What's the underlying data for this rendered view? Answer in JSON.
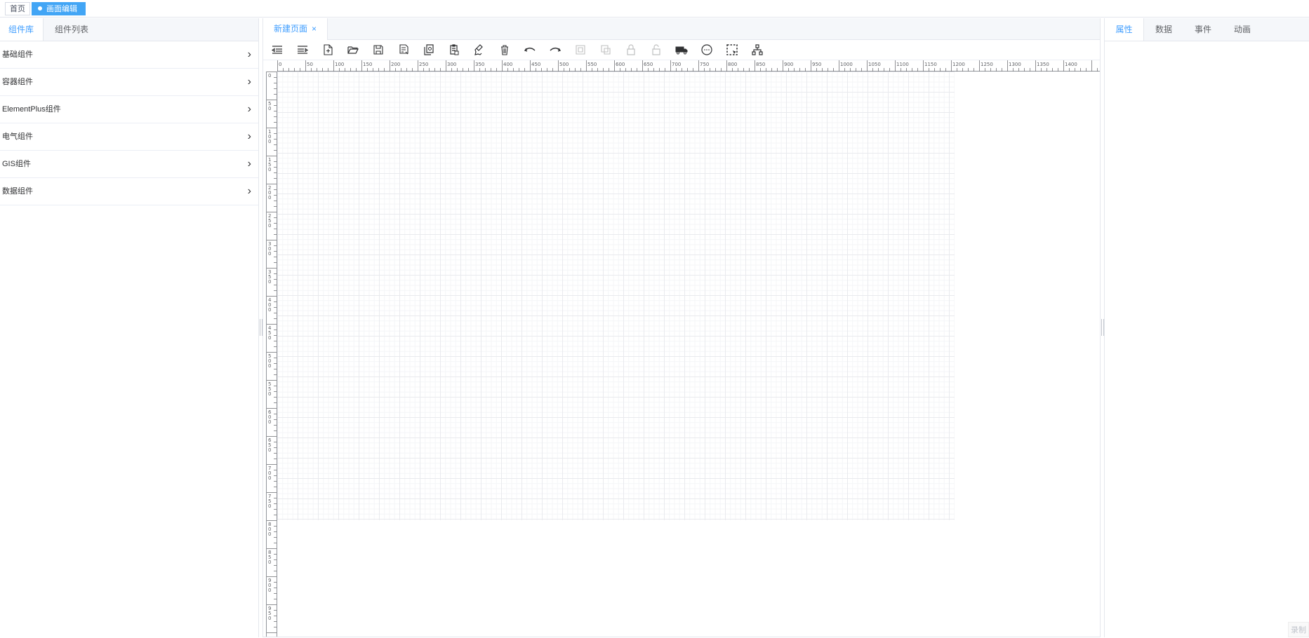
{
  "top_tabs": {
    "home": "首页",
    "active": "画面编辑",
    "close": "×"
  },
  "left_panel": {
    "tabs": [
      "组件库",
      "组件列表"
    ],
    "groups": [
      "基础组件",
      "容器组件",
      "ElementPlus组件",
      "电气组件",
      "GIS组件",
      "数据组件"
    ],
    "chevron": "›"
  },
  "center": {
    "page_tab": "新建页面",
    "close": "×",
    "ruler_top_labels": [
      "0",
      "50",
      "100",
      "150",
      "200",
      "250",
      "300",
      "350",
      "400",
      "450",
      "500",
      "550",
      "600",
      "650",
      "700",
      "750",
      "800",
      "850",
      "900",
      "950",
      "1000",
      "1050",
      "1100",
      "1150",
      "1200",
      "1250",
      "1300",
      "1350",
      "1400"
    ],
    "ruler_left_labels": [
      "0",
      "50",
      "100",
      "150",
      "200",
      "250",
      "300",
      "350",
      "400",
      "450",
      "500",
      "550",
      "600",
      "650",
      "700",
      "750",
      "800",
      "850",
      "900",
      "950"
    ],
    "toolbar": [
      {
        "name": "indent-left-icon",
        "disabled": false
      },
      {
        "name": "indent-right-icon",
        "disabled": false
      },
      {
        "name": "new-file-icon",
        "disabled": false
      },
      {
        "name": "open-folder-icon",
        "disabled": false
      },
      {
        "name": "save-icon",
        "disabled": false
      },
      {
        "name": "save-as-icon",
        "disabled": false
      },
      {
        "name": "copy-icon",
        "disabled": false
      },
      {
        "name": "paste-icon",
        "disabled": false
      },
      {
        "name": "brush-icon",
        "disabled": false
      },
      {
        "name": "delete-icon",
        "disabled": false
      },
      {
        "name": "undo-icon",
        "disabled": false
      },
      {
        "name": "redo-icon",
        "disabled": false
      },
      {
        "name": "group-icon",
        "disabled": true
      },
      {
        "name": "ungroup-icon",
        "disabled": true
      },
      {
        "name": "lock-icon",
        "disabled": true
      },
      {
        "name": "unlock-icon",
        "disabled": true
      },
      {
        "name": "truck-icon",
        "disabled": false
      },
      {
        "name": "more-icon",
        "disabled": false
      },
      {
        "name": "select-area-icon",
        "disabled": false
      },
      {
        "name": "hierarchy-icon",
        "disabled": false
      }
    ]
  },
  "right_panel": {
    "tabs": [
      "属性",
      "数据",
      "事件",
      "动画"
    ],
    "watermark": "录制"
  }
}
